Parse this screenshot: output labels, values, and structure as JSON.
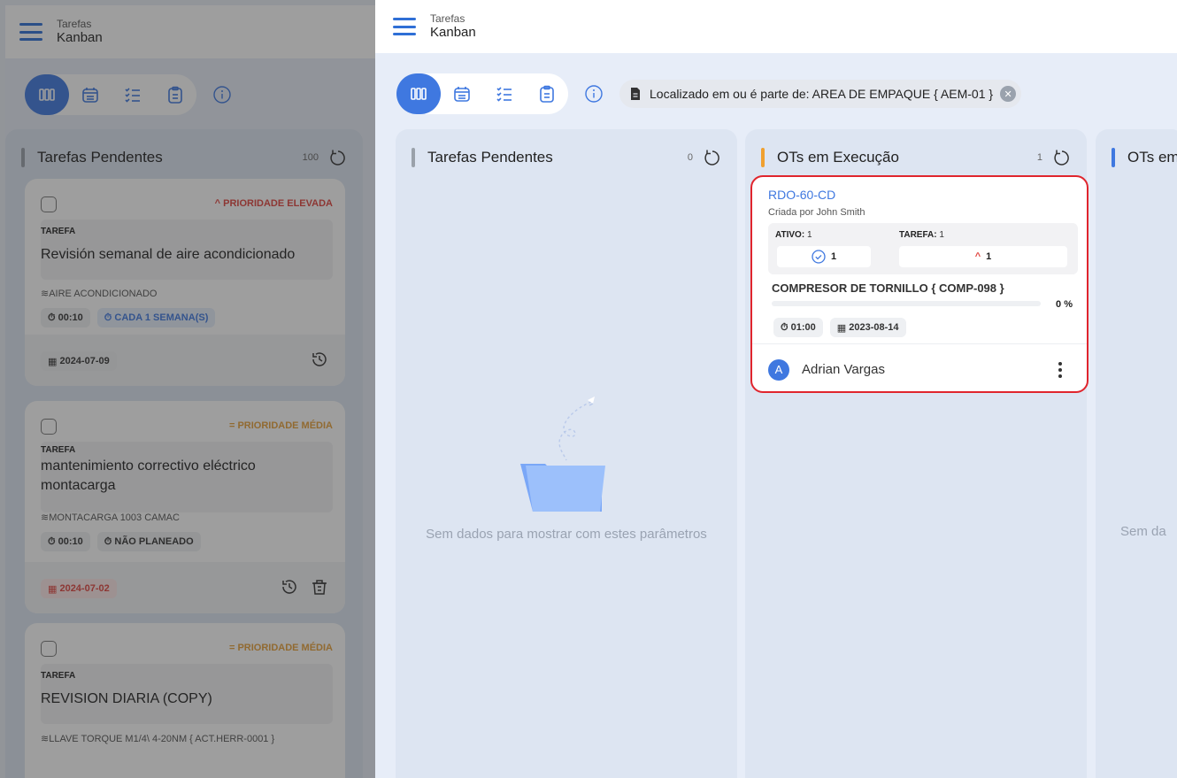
{
  "header": {
    "app_section": "Tarefas",
    "view_title": "Kanban"
  },
  "filter": {
    "label": "Localizado em ou é parte de: AREA DE EMPAQUE { AEM-01 }"
  },
  "empty_state": {
    "message": "Sem dados para mostrar com estes parâmetros",
    "message_truncated": "Sem da"
  },
  "columns": [
    {
      "title": "Tarefas Pendentes",
      "count": "0"
    },
    {
      "title": "OTs em Execução",
      "count": "1",
      "accent": "#f0a030"
    },
    {
      "title": "OTs em",
      "accent": "#3f78e0"
    }
  ],
  "work_order": {
    "id": "RDO-60-CD",
    "created_by": "Criada por John Smith",
    "asset_label": "ATIVO:",
    "asset_count": "1",
    "asset_check_value": "1",
    "task_label": "TAREFA:",
    "task_count": "1",
    "task_priority_value": "1",
    "asset_name": "COMPRESOR DE TORNILLO { COMP-098 }",
    "progress_pct": 0,
    "progress_label": "0 %",
    "duration": "01:00",
    "date": "2023-08-14",
    "assignee": "Adrian Vargas",
    "assignee_initial": "A"
  },
  "left_panel": {
    "column_title": "Tarefas Pendentes",
    "column_count": "100",
    "cards": [
      {
        "priority": "PRIORIDADE ELEVADA",
        "tag": "TAREFA",
        "name": "Revisión semanal de aire acondicionado",
        "asset": "AIRE ACONDICIONADO",
        "duration": "00:10",
        "schedule": "CADA 1 SEMANA(S)",
        "date": "2024-07-09"
      },
      {
        "priority": "PRIORIDADE MÉDIA",
        "tag": "TAREFA",
        "name": "mantenimiento correctivo eléctrico montacarga",
        "asset": "MONTACARGA 1003  CAMAC",
        "duration": "00:10",
        "schedule": "NÃO PLANEADO",
        "date": "2024-07-02"
      },
      {
        "priority": "PRIORIDADE MÉDIA",
        "tag": "TAREFA",
        "name": "REVISION DIARIA (COPY)",
        "asset": "LLAVE TORQUE M1/4\\ 4-20NM { ACT.HERR-0001 }"
      }
    ]
  },
  "colors": {
    "primary": "#3f78e0",
    "high_priority": "#e0443e",
    "medium_priority": "#e8a13a",
    "highlight_border": "#e0252d"
  }
}
